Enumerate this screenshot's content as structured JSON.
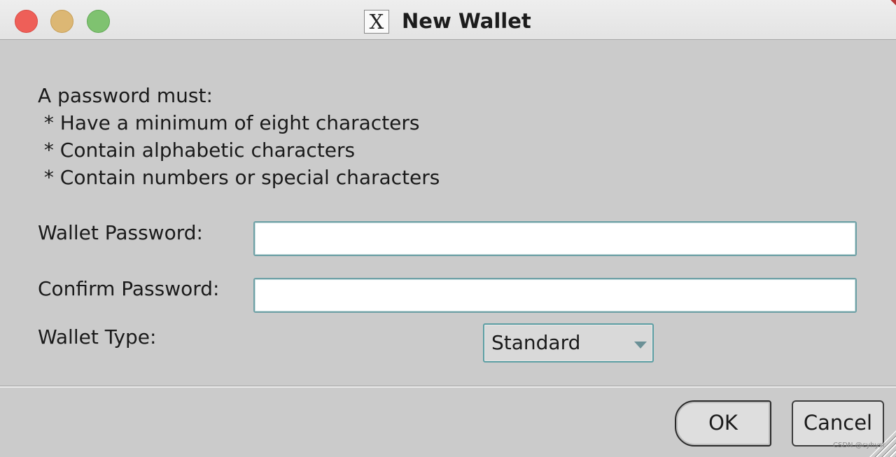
{
  "window": {
    "title": "New Wallet",
    "app_icon": "x11-icon",
    "app_icon_glyph": "X",
    "controls": [
      "close-button",
      "minimize-button",
      "zoom-button"
    ]
  },
  "requirements": {
    "heading": "A password must:",
    "items": [
      " * Have a minimum of eight characters",
      " * Contain alphabetic characters",
      " * Contain numbers or special characters"
    ]
  },
  "form": {
    "wallet_password_label": "Wallet Password:",
    "wallet_password_value": "",
    "confirm_password_label": "Confirm Password:",
    "confirm_password_value": "",
    "wallet_type_label": "Wallet Type:",
    "wallet_type_selected": "Standard"
  },
  "buttons": {
    "ok": "OK",
    "cancel": "Cancel"
  },
  "watermark": "CSDN @cyhysr"
}
